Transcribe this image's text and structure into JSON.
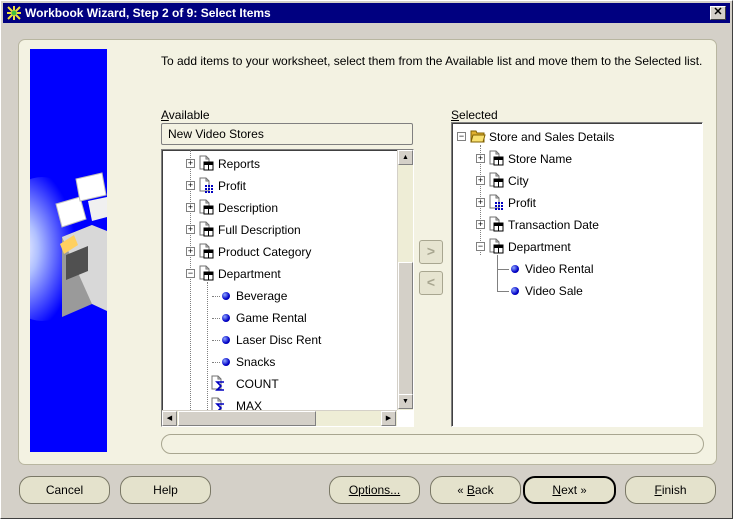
{
  "window": {
    "title": "Workbook Wizard, Step 2 of 9: Select Items",
    "close_glyph": "✕"
  },
  "instructions": "To add items to your worksheet, select them from the Available list and move them to the Selected list.",
  "available": {
    "label": "Available",
    "business_area": "New Video Stores",
    "items": [
      {
        "label": "Reports",
        "icon": "folder-table-icon"
      },
      {
        "label": "Profit",
        "icon": "folder-numeric-icon"
      },
      {
        "label": "Description",
        "icon": "folder-table-icon"
      },
      {
        "label": "Full Description",
        "icon": "folder-table-icon"
      },
      {
        "label": "Product Category",
        "icon": "folder-table-icon"
      },
      {
        "label": "Department",
        "icon": "folder-table-icon"
      },
      {
        "label": "Beverage",
        "icon": "value-dot-icon"
      },
      {
        "label": "Game Rental",
        "icon": "value-dot-icon"
      },
      {
        "label": "Laser Disc Rent",
        "icon": "value-dot-icon"
      },
      {
        "label": "Snacks",
        "icon": "value-dot-icon"
      },
      {
        "label": "COUNT",
        "icon": "sigma-aggregate-icon"
      },
      {
        "label": "MAX",
        "icon": "sigma-aggregate-icon"
      }
    ]
  },
  "selected": {
    "label": "Selected",
    "root": "Store and Sales Details",
    "items": [
      {
        "label": "Store Name",
        "icon": "folder-table-icon"
      },
      {
        "label": "City",
        "icon": "folder-table-icon"
      },
      {
        "label": "Profit",
        "icon": "folder-numeric-icon"
      },
      {
        "label": "Transaction Date",
        "icon": "folder-table-icon"
      },
      {
        "label": "Department",
        "icon": "folder-table-icon"
      },
      {
        "label": "Video Rental",
        "icon": "value-dot-icon"
      },
      {
        "label": "Video Sale",
        "icon": "value-dot-icon"
      }
    ]
  },
  "move_buttons": {
    "add_glyph": ">",
    "remove_glyph": "<"
  },
  "buttons": {
    "cancel": "Cancel",
    "help": "Help",
    "options": "Options...",
    "back": "Back",
    "next": "Next",
    "finish": "Finish"
  },
  "colors": {
    "titlebar": "#000080",
    "panel": "#f3f2e2",
    "side_graphic": "#0000ff",
    "folder": "#f0d060"
  }
}
